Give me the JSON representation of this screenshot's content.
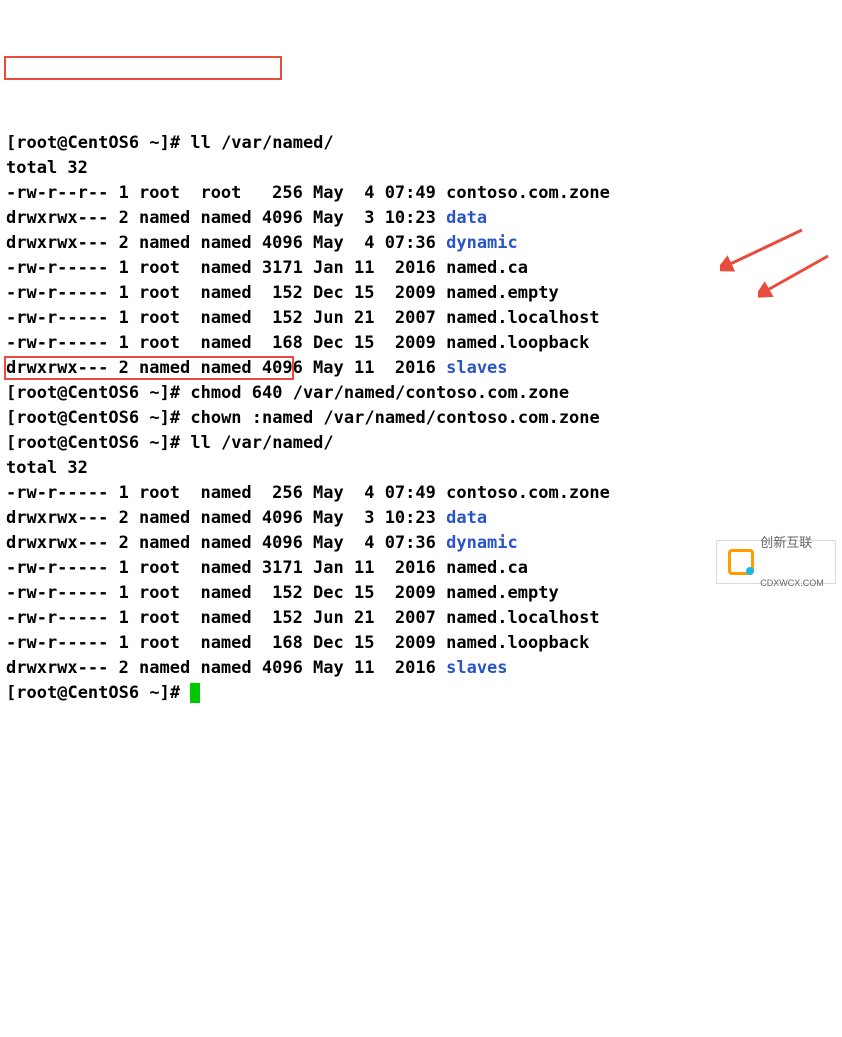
{
  "prompts": {
    "user": "root",
    "host": "CentOS6",
    "cwd": "~",
    "sep1": "@",
    "sep2": " ",
    "bracketL": "[",
    "bracketR": "]",
    "hash": "#"
  },
  "cmds": {
    "ll1": "ll /var/named/",
    "chmod": "chmod 640 /var/named/contoso.com.zone",
    "chown": "chown :named /var/named/contoso.com.zone",
    "ll2": "ll /var/named/"
  },
  "totals": {
    "t1": "total 32",
    "t2": "total 32"
  },
  "listing1": [
    {
      "perm": "-rw-r--r--",
      "links": "1",
      "owner": "root ",
      "group": "root ",
      "size": " 256",
      "date": "May  4 07:49",
      "name": "contoso.com.zone",
      "dir": false
    },
    {
      "perm": "drwxrwx---",
      "links": "2",
      "owner": "named",
      "group": "named",
      "size": "4096",
      "date": "May  3 10:23",
      "name": "data",
      "dir": true
    },
    {
      "perm": "drwxrwx---",
      "links": "2",
      "owner": "named",
      "group": "named",
      "size": "4096",
      "date": "May  4 07:36",
      "name": "dynamic",
      "dir": true
    },
    {
      "perm": "-rw-r-----",
      "links": "1",
      "owner": "root ",
      "group": "named",
      "size": "3171",
      "date": "Jan 11  2016",
      "name": "named.ca",
      "dir": false
    },
    {
      "perm": "-rw-r-----",
      "links": "1",
      "owner": "root ",
      "group": "named",
      "size": " 152",
      "date": "Dec 15  2009",
      "name": "named.empty",
      "dir": false
    },
    {
      "perm": "-rw-r-----",
      "links": "1",
      "owner": "root ",
      "group": "named",
      "size": " 152",
      "date": "Jun 21  2007",
      "name": "named.localhost",
      "dir": false
    },
    {
      "perm": "-rw-r-----",
      "links": "1",
      "owner": "root ",
      "group": "named",
      "size": " 168",
      "date": "Dec 15  2009",
      "name": "named.loopback",
      "dir": false
    },
    {
      "perm": "drwxrwx---",
      "links": "2",
      "owner": "named",
      "group": "named",
      "size": "4096",
      "date": "May 11  2016",
      "name": "slaves",
      "dir": true
    }
  ],
  "listing2": [
    {
      "perm": "-rw-r-----",
      "links": "1",
      "owner": "root ",
      "group": "named",
      "size": " 256",
      "date": "May  4 07:49",
      "name": "contoso.com.zone",
      "dir": false
    },
    {
      "perm": "drwxrwx---",
      "links": "2",
      "owner": "named",
      "group": "named",
      "size": "4096",
      "date": "May  3 10:23",
      "name": "data",
      "dir": true
    },
    {
      "perm": "drwxrwx---",
      "links": "2",
      "owner": "named",
      "group": "named",
      "size": "4096",
      "date": "May  4 07:36",
      "name": "dynamic",
      "dir": true
    },
    {
      "perm": "-rw-r-----",
      "links": "1",
      "owner": "root ",
      "group": "named",
      "size": "3171",
      "date": "Jan 11  2016",
      "name": "named.ca",
      "dir": false
    },
    {
      "perm": "-rw-r-----",
      "links": "1",
      "owner": "root ",
      "group": "named",
      "size": " 152",
      "date": "Dec 15  2009",
      "name": "named.empty",
      "dir": false
    },
    {
      "perm": "-rw-r-----",
      "links": "1",
      "owner": "root ",
      "group": "named",
      "size": " 152",
      "date": "Jun 21  2007",
      "name": "named.localhost",
      "dir": false
    },
    {
      "perm": "-rw-r-----",
      "links": "1",
      "owner": "root ",
      "group": "named",
      "size": " 168",
      "date": "Dec 15  2009",
      "name": "named.loopback",
      "dir": false
    },
    {
      "perm": "drwxrwx---",
      "links": "2",
      "owner": "named",
      "group": "named",
      "size": "4096",
      "date": "May 11  2016",
      "name": "slaves",
      "dir": true
    }
  ],
  "watermark": {
    "line1": "创新互联",
    "line2": "CDXWCX.COM"
  }
}
